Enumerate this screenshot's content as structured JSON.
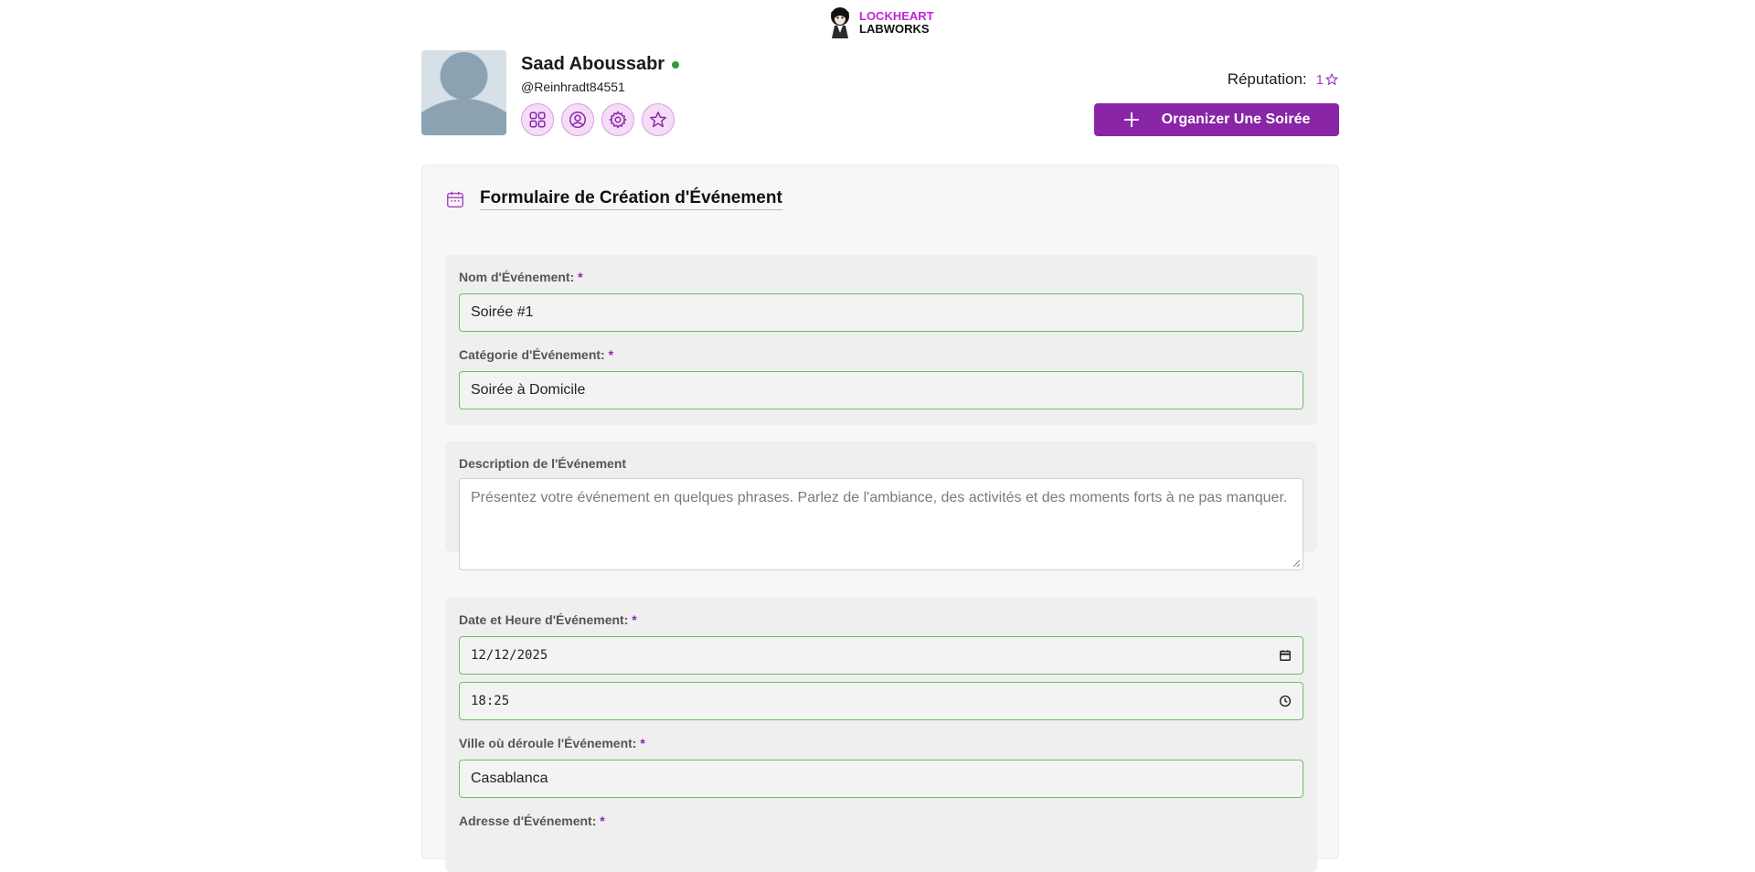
{
  "brand": {
    "line1": "LOCKHEART",
    "line2": "LABWORKS"
  },
  "user": {
    "name": "Saad Aboussabr",
    "handle": "@Reinhradt84551",
    "status": "online"
  },
  "user_icons": [
    "grid-icon",
    "profile-icon",
    "settings-icon",
    "star-icon"
  ],
  "reputation": {
    "label": "Réputation:",
    "value": "1"
  },
  "cta": {
    "label": "Organizer Une Soirée"
  },
  "form": {
    "title": "Formulaire de Création d'Événement",
    "name_label": "Nom d'Événement:",
    "name_value": "Soirée #1",
    "category_label": "Catégorie d'Événement:",
    "category_value": "Soirée à Domicile",
    "description_label": "Description de l'Événement",
    "description_placeholder": "Présentez votre événement en quelques phrases. Parlez de l'ambiance, des activités et des moments forts à ne pas manquer.",
    "datetime_label": "Date et Heure d'Événement:",
    "date_value": "12/12/2025",
    "time_value": "18:25",
    "city_label": "Ville où déroule l'Événement:",
    "city_value": "Casablanca",
    "address_label": "Adresse d'Événement:",
    "required_mark": "*"
  },
  "colors": {
    "accent": "#8a25a8",
    "valid_border": "#6cc065",
    "online": "#2e9d3f"
  }
}
